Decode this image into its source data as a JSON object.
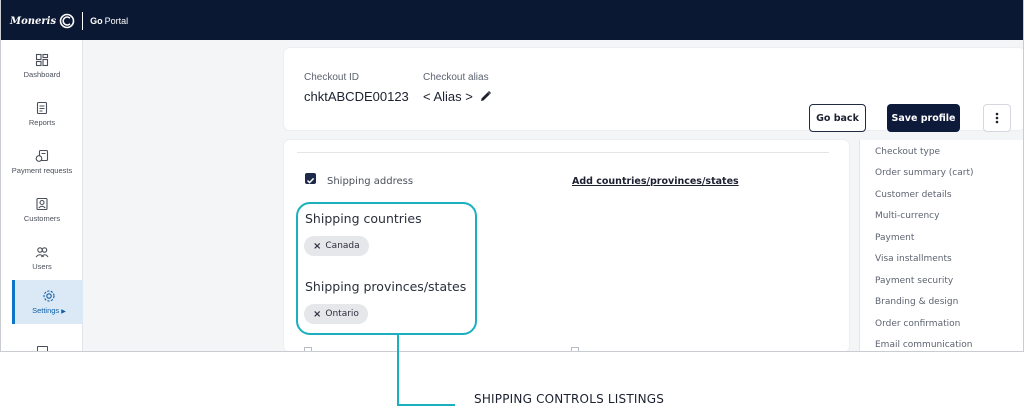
{
  "brand": {
    "name": "Moneris",
    "go": "Go",
    "portal": "Portal"
  },
  "sidebar": {
    "items": [
      {
        "label": "Dashboard",
        "icon": "dashboard-icon"
      },
      {
        "label": "Reports",
        "icon": "reports-icon"
      },
      {
        "label": "Payment requests",
        "icon": "payment-requests-icon"
      },
      {
        "label": "Customers",
        "icon": "customers-icon"
      },
      {
        "label": "Users",
        "icon": "users-icon"
      },
      {
        "label": "Settings",
        "icon": "settings-icon",
        "active": true
      }
    ]
  },
  "header": {
    "checkout_id_label": "Checkout ID",
    "checkout_id_value": "chktABCDE00123",
    "alias_label": "Checkout alias",
    "alias_value": "< Alias >",
    "go_back": "Go back",
    "save_profile": "Save profile"
  },
  "shipping": {
    "checkbox_label": "Shipping address",
    "checked": true,
    "add_link": "Add countries/provinces/states",
    "countries_title": "Shipping countries",
    "countries": [
      "Canada"
    ],
    "provinces_title": "Shipping provinces/states",
    "provinces": [
      "Ontario"
    ]
  },
  "right_nav": {
    "items": [
      "Checkout type",
      "Order summary (cart)",
      "Customer details",
      "Multi-currency",
      "Payment",
      "Visa installments",
      "Payment security",
      "Branding & design",
      "Order confirmation",
      "Email communication"
    ]
  },
  "callout": {
    "text": "SHIPPING CONTROLS LISTINGS"
  },
  "colors": {
    "topbar": "#0b1834",
    "accent": "#1ab0bf",
    "active_nav": "#dbe9f6",
    "primary_button": "#0e1a3a"
  }
}
